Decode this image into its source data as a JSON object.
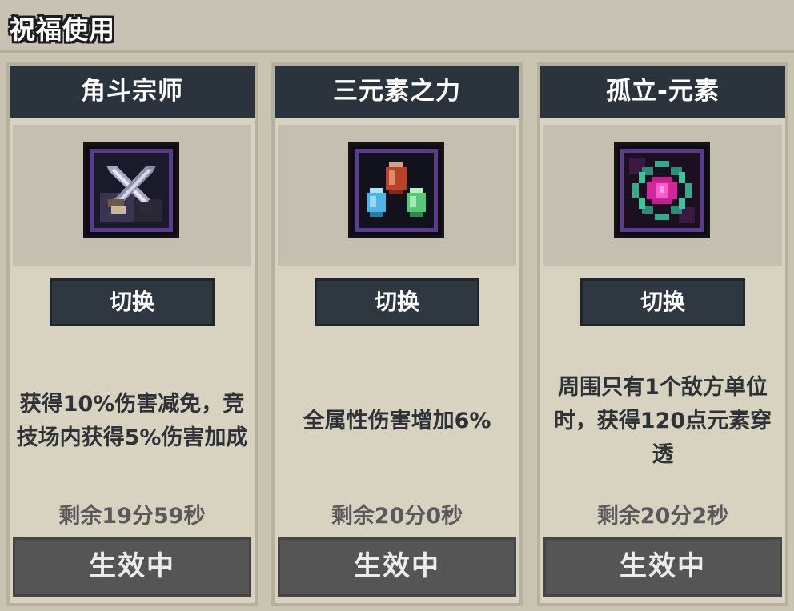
{
  "page": {
    "title": "祝福使用"
  },
  "cards": [
    {
      "title": "角斗宗师",
      "icon": "crossed-swords-icon",
      "switch_label": "切换",
      "description": "获得10%伤害减免，竞技场内获得5%伤害加成",
      "remaining": "剩余19分59秒",
      "status_label": "生效中"
    },
    {
      "title": "三元素之力",
      "icon": "three-elemental-gems-icon",
      "switch_label": "切换",
      "description": "全属性伤害增加6%",
      "remaining": "剩余20分0秒",
      "status_label": "生效中"
    },
    {
      "title": "孤立-元素",
      "icon": "element-orb-icon",
      "switch_label": "切换",
      "description": "周围只有1个敌方单位时，获得120点元素穿透",
      "remaining": "剩余20分2秒",
      "status_label": "生效中"
    }
  ],
  "colors": {
    "panel_bg": "#d8d2c1",
    "title_bar": "#2b343c",
    "active_button": "#555555",
    "icon_frame_purple": "#5b3c8a"
  }
}
